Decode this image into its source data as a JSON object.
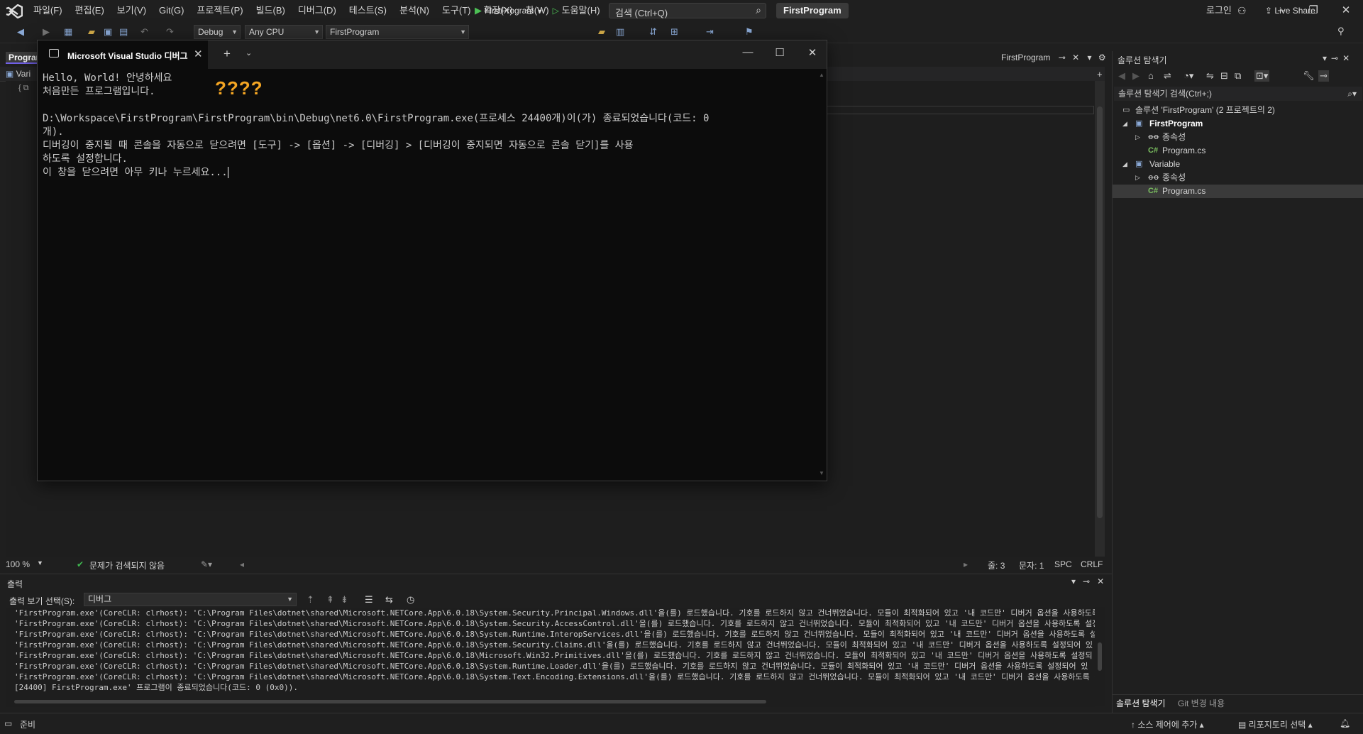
{
  "menubar": {
    "items": [
      "파일(F)",
      "편집(E)",
      "보기(V)",
      "Git(G)",
      "프로젝트(P)",
      "빌드(B)",
      "디버그(D)",
      "테스트(S)",
      "분석(N)",
      "도구(T)",
      "확장(X)",
      "창(W)",
      "도움말(H)"
    ],
    "search_placeholder": "검색 (Ctrl+Q)",
    "solution_name": "FirstProgram",
    "login": "로그인"
  },
  "toolbar": {
    "config": "Debug",
    "platform": "Any CPU",
    "startup_project": "FirstProgram",
    "run_label": "FirstProgram",
    "live_share": "Live Share"
  },
  "editor": {
    "left_tab": "Program.cs",
    "right_tab": "FirstProgram",
    "nav_left": "Vari",
    "zoom": "100 %",
    "issues": "문제가 검색되지 않음",
    "line": "줄: 3",
    "char": "문자: 1",
    "whitespace": "SPC",
    "line_ending": "CRLF"
  },
  "console": {
    "title": "Microsoft Visual Studio 디버그",
    "lines": [
      "Hello, World! 안녕하세요",
      "처음만든 프로그램입니다.",
      "",
      "D:\\Workspace\\FirstProgram\\FirstProgram\\bin\\Debug\\net6.0\\FirstProgram.exe(프로세스 24400개)이(가) 종료되었습니다(코드: 0",
      "개).",
      "디버깅이 중지될 때 콘솔을 자동으로 닫으려면 [도구] -> [옵션] -> [디버깅] > [디버깅이 중지되면 자동으로 콘솔 닫기]를 사용",
      "하도록 설정합니다.",
      "이 창을 닫으려면 아무 키나 누르세요..."
    ],
    "annotation": "????"
  },
  "output": {
    "title": "출력",
    "source_label": "출력 보기 선택(S):",
    "source_value": "디버그",
    "lines": [
      "'FirstProgram.exe'(CoreCLR: clrhost): 'C:\\Program Files\\dotnet\\shared\\Microsoft.NETCore.App\\6.0.18\\System.Security.Principal.Windows.dll'을(를) 로드했습니다. 기호를 로드하지 않고 건너뛰었습니다. 모듈이 최적화되어 있고 '내 코드만' 디버거 옵션을 사용하도록 설정되어",
      "'FirstProgram.exe'(CoreCLR: clrhost): 'C:\\Program Files\\dotnet\\shared\\Microsoft.NETCore.App\\6.0.18\\System.Security.AccessControl.dll'을(를) 로드했습니다. 기호를 로드하지 않고 건너뛰었습니다. 모듈이 최적화되어 있고 '내 코드만' 디버거 옵션을 사용하도록 설정",
      "'FirstProgram.exe'(CoreCLR: clrhost): 'C:\\Program Files\\dotnet\\shared\\Microsoft.NETCore.App\\6.0.18\\System.Runtime.InteropServices.dll'을(를) 로드했습니다. 기호를 로드하지 않고 건너뛰었습니다. 모듈이 최적화되어 있고 '내 코드만' 디버거 옵션을 사용하도록 설",
      "'FirstProgram.exe'(CoreCLR: clrhost): 'C:\\Program Files\\dotnet\\shared\\Microsoft.NETCore.App\\6.0.18\\System.Security.Claims.dll'을(를) 로드했습니다. 기호를 로드하지 않고 건너뛰었습니다. 모듈이 최적화되어 있고 '내 코드만' 디버거 옵션을 사용하도록 설정되어 있",
      "'FirstProgram.exe'(CoreCLR: clrhost): 'C:\\Program Files\\dotnet\\shared\\Microsoft.NETCore.App\\6.0.18\\Microsoft.Win32.Primitives.dll'을(를) 로드했습니다. 기호를 로드하지 않고 건너뛰었습니다. 모듈이 최적화되어 있고 '내 코드만' 디버거 옵션을 사용하도록 설정되",
      "'FirstProgram.exe'(CoreCLR: clrhost): 'C:\\Program Files\\dotnet\\shared\\Microsoft.NETCore.App\\6.0.18\\System.Runtime.Loader.dll'을(를) 로드했습니다. 기호를 로드하지 않고 건너뛰었습니다. 모듈이 최적화되어 있고 '내 코드만' 디버거 옵션을 사용하도록 설정되어 있",
      "'FirstProgram.exe'(CoreCLR: clrhost): 'C:\\Program Files\\dotnet\\shared\\Microsoft.NETCore.App\\6.0.18\\System.Text.Encoding.Extensions.dll'을(를) 로드했습니다. 기호를 로드하지 않고 건너뛰었습니다. 모듈이 최적화되어 있고 '내 코드만' 디버거 옵션을 사용하도록 설",
      "[24400] FirstProgram.exe' 프로그램이 종료되었습니다(코드: 0 (0x0))."
    ]
  },
  "solution_explorer": {
    "title": "솔루션 탐색기",
    "search_placeholder": "솔루션 탐색기 검색(Ctrl+;)",
    "solution_label": "솔루션 'FirstProgram' (2 프로젝트의 2)",
    "projects": [
      {
        "name": "FirstProgram",
        "deps": "종속성",
        "file": "Program.cs"
      },
      {
        "name": "Variable",
        "deps": "종속성",
        "file": "Program.cs"
      }
    ],
    "bottom_tabs": [
      "솔루션 탐색기",
      "Git 변경 내용"
    ]
  },
  "statusbar": {
    "ready": "준비",
    "source_control": "소스 제어에 추가",
    "repository": "리포지토리 선택"
  },
  "colors": {
    "background": "#1f1f1f",
    "console_bg": "#0c0c0c",
    "accent_purple": "#7160e8",
    "annotation_orange": "#f5a623",
    "ok_green": "#3fb950"
  }
}
